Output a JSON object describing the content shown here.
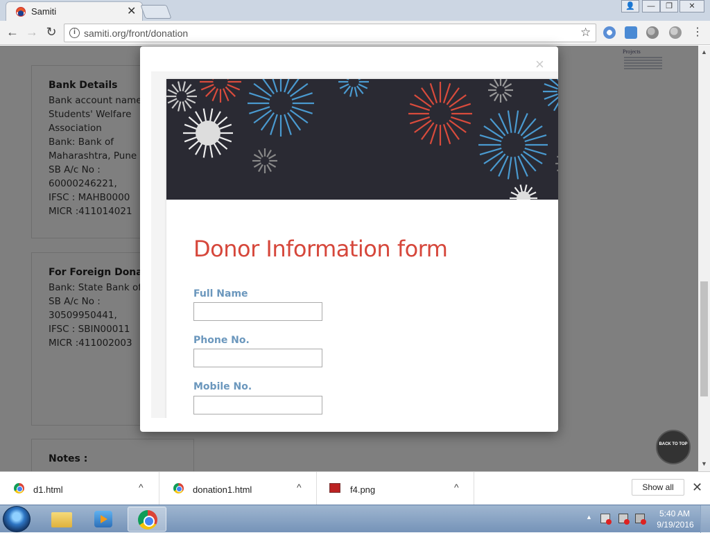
{
  "browser": {
    "tab_title": "Samiti",
    "tab_close": "✕",
    "url": "samiti.org/front/donation",
    "window_buttons": {
      "user": "👤",
      "min": "—",
      "max": "❐",
      "close": "✕"
    }
  },
  "page": {
    "bank_card": {
      "heading": "Bank Details",
      "lines": [
        "Bank account name",
        "Students' Welfare",
        "Association",
        "Bank: Bank of",
        "Maharashtra, Pune",
        "SB A/c No :",
        "60000246221,",
        "IFSC : MAHB0000",
        "MICR :411014021"
      ]
    },
    "foreign_card": {
      "heading": "For Foreign Donations",
      "lines": [
        "Bank: State Bank of",
        "SB A/c No :",
        "30509950441,",
        "IFSC : SBIN00011",
        "MICR :411002003"
      ]
    },
    "notes_card": {
      "heading": "Notes :"
    },
    "sidebar_title": "Projects",
    "back_to_top": "BACK TO TOP"
  },
  "modal": {
    "close": "×",
    "form_title": "Donor Information form",
    "fields": [
      {
        "label": "Full Name",
        "value": ""
      },
      {
        "label": "Phone No.",
        "value": ""
      },
      {
        "label": "Mobile No.",
        "value": ""
      }
    ]
  },
  "downloads": {
    "items": [
      {
        "name": "d1.html",
        "icon": "chrome-icon"
      },
      {
        "name": "donation1.html",
        "icon": "chrome-icon"
      },
      {
        "name": "f4.png",
        "icon": "image-file-icon"
      }
    ],
    "caret": "^",
    "show_all": "Show all",
    "close": "✕"
  },
  "taskbar": {
    "time": "5:40 AM",
    "date": "9/19/2016",
    "tray_arrow": "▲"
  },
  "colors": {
    "accent_title": "#d6473b",
    "field_label": "#6b97bd",
    "banner_bg": "#2a2a33"
  }
}
